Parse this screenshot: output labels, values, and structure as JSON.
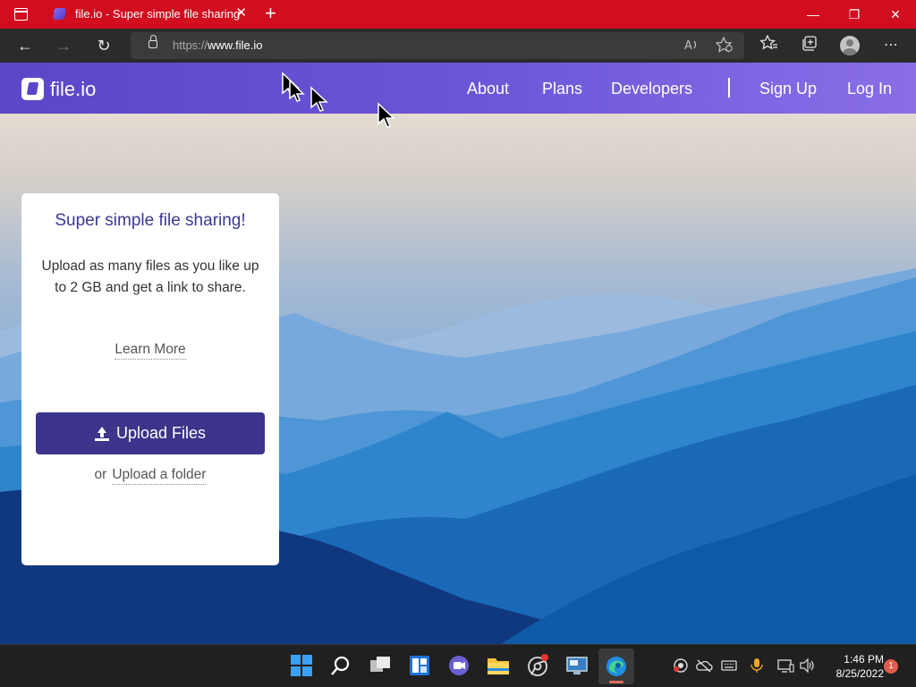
{
  "browser": {
    "tab": {
      "title": "file.io - Super simple file sharing",
      "close": "✕"
    },
    "new_tab": "+",
    "window_controls": {
      "minimize": "—",
      "restore": "❐",
      "close": "✕"
    },
    "nav": {
      "back": "←",
      "forward": "→",
      "refresh": "↻"
    },
    "address": {
      "scheme": "https://",
      "host": "www.file.io"
    },
    "toolbar_icons": [
      "read-aloud-icon",
      "add-favorite-icon",
      "favorites-icon",
      "collections-icon",
      "profile-icon",
      "more-icon"
    ],
    "more": "⋯"
  },
  "site": {
    "logo_text": "file.io",
    "nav": [
      "About",
      "Plans",
      "Developers",
      "Sign Up",
      "Log In"
    ],
    "card": {
      "headline": "Super simple file sharing!",
      "description": "Upload as many files as you like up to 2 GB and get a link to share.",
      "learn_more": "Learn More",
      "upload_button": "Upload Files",
      "or_text": "or",
      "upload_folder": "Upload a folder"
    }
  },
  "taskbar": {
    "apps": [
      "start-icon",
      "search-icon",
      "task-view-icon",
      "widgets-icon",
      "teams-chat-icon",
      "file-explorer-icon",
      "chrome-icon",
      "remote-desktop-icon",
      "edge-icon"
    ],
    "clock": {
      "time": "1:46 PM",
      "date": "8/25/2022"
    },
    "notification_count": "1"
  },
  "colors": {
    "tabbar": "#d10d1f",
    "site_nav_start": "#5a47c7",
    "site_nav_end": "#8a6ee8",
    "primary_button": "#3d348b",
    "headline": "#3c3893"
  }
}
